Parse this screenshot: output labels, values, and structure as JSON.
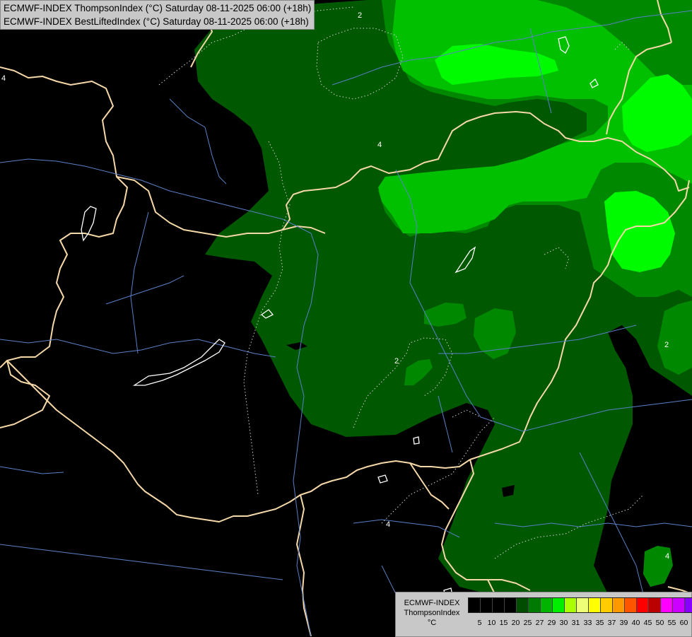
{
  "header": {
    "line1": "ECMWF-INDEX ThompsonIndex (°C) Saturday 08-11-2025 06:00 (+18h)",
    "line2": "ECMWF-INDEX BestLiftedIndex (°C) Saturday 08-11-2025 06:00 (+18h)"
  },
  "legend": {
    "title_line1": "ECMWF-INDEX",
    "title_line2": "ThompsonIndex",
    "unit": "°C",
    "colors": [
      "#000000",
      "#000000",
      "#000000",
      "#000000",
      "#004d00",
      "#007a00",
      "#00b400",
      "#00ee00",
      "#aaff00",
      "#eeff77",
      "#ffff00",
      "#ffcc00",
      "#ff9900",
      "#ff5500",
      "#ff0000",
      "#bb0000",
      "#ff00ff",
      "#cc00ff",
      "#8800ff",
      "#3300ff",
      "#0000ff"
    ],
    "ticks": [
      "5",
      "10",
      "15",
      "20",
      "25",
      "27",
      "29",
      "30",
      "31",
      "33",
      "35",
      "37",
      "39",
      "40",
      "45",
      "50",
      "55",
      "60"
    ]
  },
  "contour_labels": [
    "2",
    "4",
    "4",
    "2",
    "2",
    "4",
    "2",
    "4"
  ],
  "palette": {
    "background": "#000000",
    "dark_green": "#005400",
    "mid_green": "#008400",
    "light_green": "#00b800",
    "bright_green": "#00f800",
    "borders": "#f5d8a8",
    "rivers": "#5a80c8",
    "lakes": "#ffffff"
  }
}
